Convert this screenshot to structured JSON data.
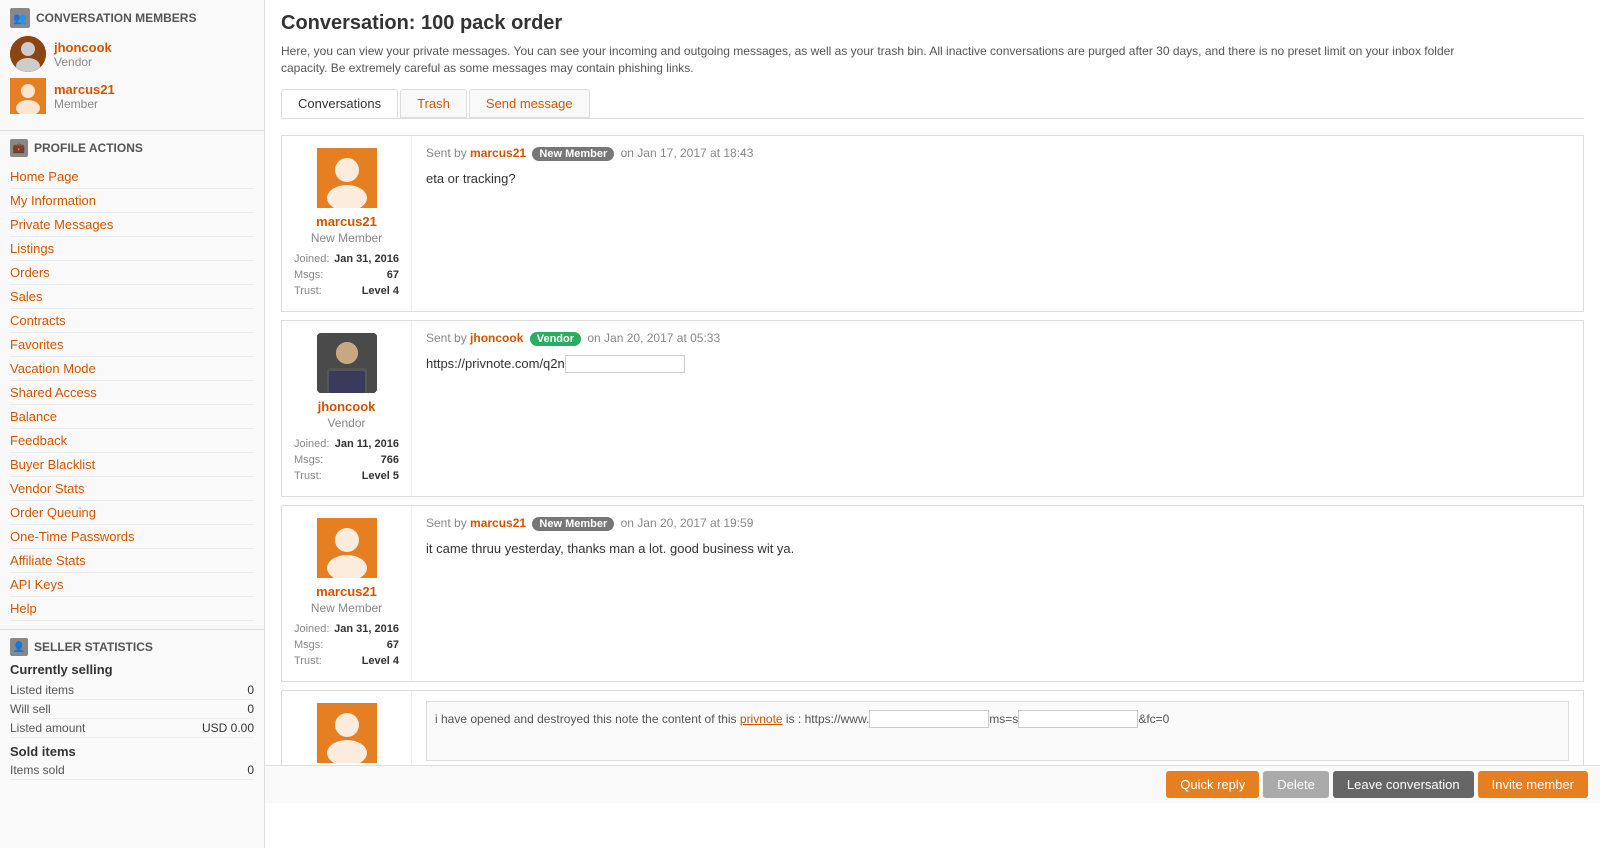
{
  "sidebar": {
    "conv_members_header": "CONVERSATION MEMBERS",
    "members": [
      {
        "username": "jhoncook",
        "role": "Vendor",
        "type": "vendor"
      },
      {
        "username": "marcus21",
        "role": "Member",
        "type": "member"
      }
    ],
    "profile_actions_header": "PROFILE ACTIONS",
    "nav_links": [
      "Home Page",
      "My Information",
      "Private Messages",
      "Listings",
      "Orders",
      "Sales",
      "Contracts",
      "Favorites",
      "Vacation Mode",
      "Shared Access",
      "Balance",
      "Feedback",
      "Buyer Blacklist",
      "Vendor Stats",
      "Order Queuing",
      "One-Time Passwords",
      "Affiliate Stats",
      "API Keys",
      "Help"
    ],
    "seller_stats_header": "SELLER STATISTICS",
    "currently_selling_label": "Currently selling",
    "stats_currently": [
      {
        "label": "Listed items",
        "value": "0"
      },
      {
        "label": "Will sell",
        "value": "0"
      },
      {
        "label": "Listed amount",
        "value": "USD 0.00"
      }
    ],
    "sold_items_label": "Sold items",
    "stats_sold": [
      {
        "label": "Items sold",
        "value": "0"
      }
    ]
  },
  "main": {
    "page_title": "Conversation: 100 pack order",
    "page_description": "Here, you can view your private messages. You can see your incoming and outgoing messages, as well as your trash bin. All inactive conversations are purged after 30 days, and there is no preset limit on your inbox folder capacity. Be extremely careful as some messages may contain phishing links.",
    "tabs": [
      {
        "label": "Conversations",
        "active": true,
        "orange": false
      },
      {
        "label": "Trash",
        "active": false,
        "orange": true
      },
      {
        "label": "Send message",
        "active": false,
        "orange": true
      }
    ],
    "messages": [
      {
        "author": "marcus21",
        "author_role": "New Member",
        "author_type": "member",
        "joined": "Jan 31, 2016",
        "msgs": "67",
        "trust": "Level 4",
        "badge": "New Member",
        "badge_type": "new_member",
        "sent_by": "marcus21",
        "timestamp": "on Jan 17, 2017 at 18:43",
        "text": "eta or tracking?"
      },
      {
        "author": "jhoncook",
        "author_role": "Vendor",
        "author_type": "vendor",
        "joined": "Jan 11, 2016",
        "msgs": "766",
        "trust": "Level 5",
        "badge": "Vendor",
        "badge_type": "vendor",
        "sent_by": "jhoncook",
        "timestamp": "on Jan 20, 2017 at 05:33",
        "text": "https://privnote.com/q2n",
        "has_input": true
      },
      {
        "author": "marcus21",
        "author_role": "New Member",
        "author_type": "member",
        "joined": "Jan 31, 2016",
        "msgs": "67",
        "trust": "Level 4",
        "badge": "New Member",
        "badge_type": "new_member",
        "sent_by": "marcus21",
        "timestamp": "on Jan 20, 2017 at 19:59",
        "text": "it came thruu yesterday, thanks man a lot. good business wit ya."
      },
      {
        "author": "",
        "author_role": "",
        "author_type": "member",
        "is_last": true,
        "text_partial_1": "i have opened and destroyed this note the content of this ",
        "text_link": "privnote",
        "text_partial_2": " is : https://www.",
        "text_partial_3": "ms=s",
        "text_partial_4": "&fc=0"
      }
    ],
    "bottom_bar": {
      "quick_reply": "Quick reply",
      "delete": "Delete",
      "leave_conversation": "Leave conversation",
      "invite_member": "Invite member"
    }
  }
}
